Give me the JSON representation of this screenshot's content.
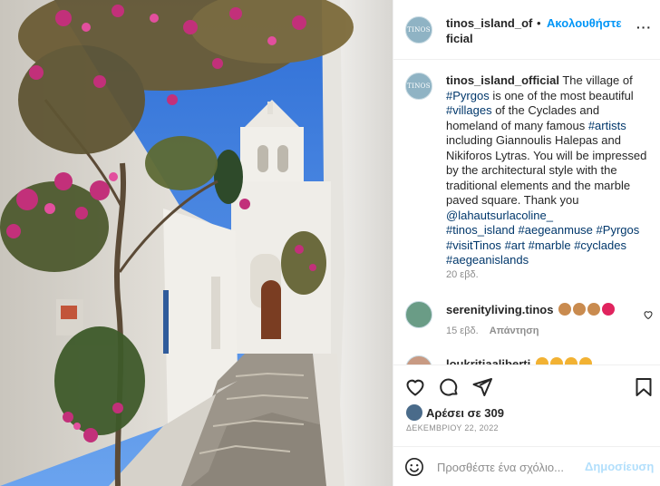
{
  "account": {
    "username": "tinos_island_official",
    "avatar_text": "TINOS",
    "follow_label": "Ακολουθήστε",
    "more_label": "···"
  },
  "caption": {
    "username": "tinos_island_official",
    "t1": " The village of ",
    "h1": "#Pyrgos",
    "t2": " is one of the most beautiful ",
    "h2": "#villages",
    "t3": " of the Cyclades and homeland of many famous ",
    "h3": "#artists",
    "t4": " including Giannoulis Halepas and Nikiforos Lytras. You will be impressed by the architectural style with the traditional elements and the marble paved square. Thank you ",
    "mention": "@lahautsurlacoline_",
    "tags": [
      "#tinos_island",
      "#aegeanmuse",
      "#Pyrgos",
      "#visitTinos",
      "#art",
      "#marble",
      "#cyclades",
      "#aegeanislands"
    ],
    "time": "20 εβδ."
  },
  "comments": [
    {
      "username": "serenityliving.tinos",
      "emojis": [
        "#c98b4f",
        "#c98b4f",
        "#c98b4f",
        "#e0245e"
      ],
      "time": "15 εβδ.",
      "reply_label": "Απάντηση"
    },
    {
      "username": "loukritiaaliberti",
      "emojis": [
        "#f2b233",
        "#f2b233",
        "#f2b233",
        "#f2b233"
      ]
    }
  ],
  "actions": {
    "like_icon": "heart-icon",
    "comment_icon": "comment-icon",
    "share_icon": "paper-plane-icon",
    "save_icon": "bookmark-icon"
  },
  "likes": {
    "text": "Αρέσει σε 309"
  },
  "date": "ΔΕΚΕΜΒΡΙΟΥ 22, 2022",
  "add_comment": {
    "placeholder": "Προσθέστε ένα σχόλιο...",
    "post_label": "Δημοσίευση"
  },
  "colors": {
    "link": "#00376b",
    "accent": "#0095f6",
    "post_disabled": "#b2dffc"
  }
}
